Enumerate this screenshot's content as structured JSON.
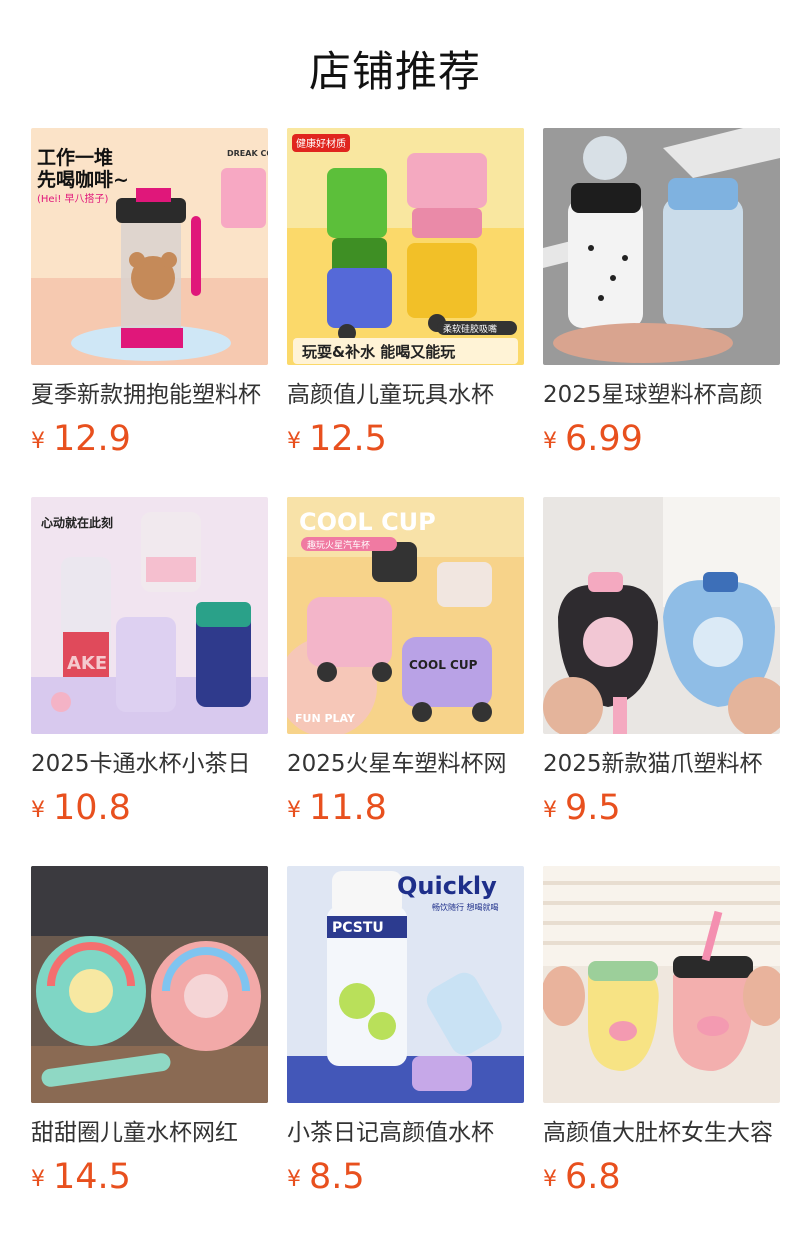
{
  "section": {
    "title": "店铺推荐"
  },
  "currency_symbol": "¥",
  "products": [
    {
      "name": "夏季新款拥抱能塑料杯",
      "price": "12.9",
      "image_text": {
        "line1": "工作一堆",
        "line2": "先喝咖啡~",
        "tag": "(Hei! 早八搭子)",
        "corner": "DREAK COFFEE"
      }
    },
    {
      "name": "高颜值儿童玩具水杯",
      "price": "12.5",
      "image_text": {
        "badge": "健康好材质",
        "bottom": "玩耍&补水  能喝又能玩",
        "chip": "柔软硅胶吸嘴"
      }
    },
    {
      "name": "2025星球塑料杯高颜",
      "price": "6.99",
      "image_text": {}
    },
    {
      "name": "2025卡通水杯小茶日",
      "price": "10.8",
      "image_text": {
        "headline": "心动就在此刻",
        "word": "AKE"
      }
    },
    {
      "name": "2025火星车塑料杯网",
      "price": "11.8",
      "image_text": {
        "headline": "COOL CUP",
        "sub": "趣玩火星汽车杯",
        "footer": "FUN PLAY",
        "cup": "COOL CUP"
      }
    },
    {
      "name": "2025新款猫爪塑料杯",
      "price": "9.5",
      "image_text": {}
    },
    {
      "name": "甜甜圈儿童水杯网红",
      "price": "14.5",
      "image_text": {}
    },
    {
      "name": "小茶日记高颜值水杯",
      "price": "8.5",
      "image_text": {
        "brand": "Quickly",
        "sub": "畅饮随行 想喝就喝",
        "label": "PCSTU"
      }
    },
    {
      "name": "高颜值大肚杯女生大容",
      "price": "6.8",
      "image_text": {}
    }
  ]
}
